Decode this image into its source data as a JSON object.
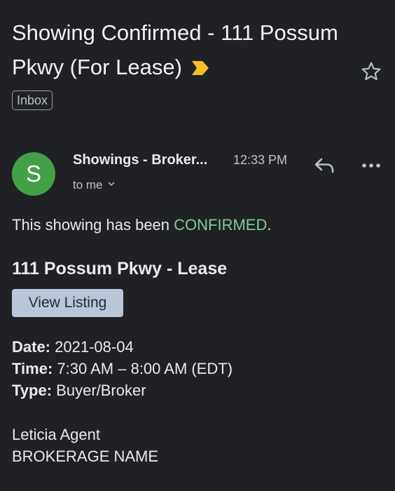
{
  "email": {
    "subject": "Showing Confirmed - 111 Possum Pkwy (For Lease)",
    "label": "Inbox",
    "important_marker": "important-marker-icon",
    "important_color": "#f6bf26",
    "starred": false,
    "sender": {
      "avatar_letter": "S",
      "avatar_color": "#43a047",
      "name": "Showings - Broker...",
      "time": "12:33 PM",
      "recipient": "to me"
    },
    "actions": {
      "reply_icon": "reply-icon",
      "more_icon": "more-options-icon"
    },
    "body": {
      "intro_prefix": "This showing has been ",
      "intro_status": "CONFIRMED",
      "intro_suffix": ".",
      "status_color": "#81c995",
      "listing_title": "111 Possum Pkwy - Lease",
      "view_listing_label": "View Listing",
      "details": [
        {
          "key": "Date:",
          "value": "2021-08-04"
        },
        {
          "key": "Time:",
          "value": "7:30 AM – 8:00 AM (EDT)"
        },
        {
          "key": "Type:",
          "value": "Buyer/Broker"
        }
      ],
      "signature_name": "Leticia Agent",
      "signature_company": "BROKERAGE NAME"
    }
  }
}
